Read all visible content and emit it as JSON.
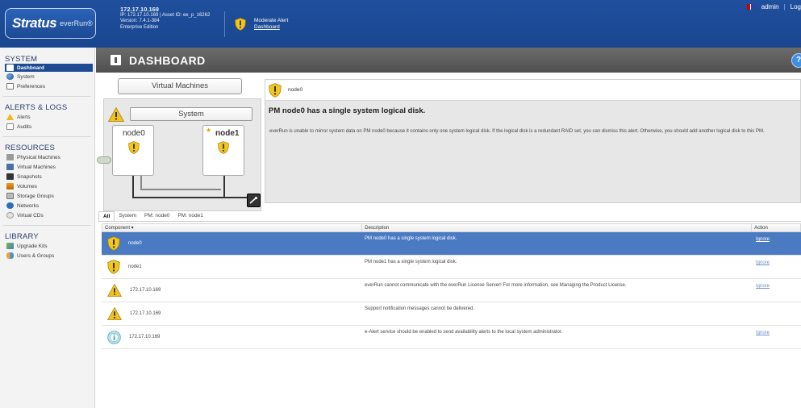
{
  "header": {
    "brand": "Stratus",
    "product": "everRun®",
    "host_ip": "172.17.10.169",
    "ip_line": "IP: 172.17.10.169 | Asset ID: ee_p_16262",
    "version": "Version: 7.4.1-384",
    "edition": "Enterprise Edition",
    "alert_level": "Moderate Alert",
    "alert_link": "Dashboard",
    "user": "admin",
    "logout": "Log"
  },
  "sidebar": {
    "system_title": "SYSTEM",
    "system_items": [
      {
        "label": "Dashboard",
        "icon": "dashboard-icon"
      },
      {
        "label": "System",
        "icon": "globe-icon"
      },
      {
        "label": "Preferences",
        "icon": "preferences-icon"
      }
    ],
    "alerts_title": "ALERTS & LOGS",
    "alerts_items": [
      {
        "label": "Alerts",
        "icon": "warning-icon"
      },
      {
        "label": "Audits",
        "icon": "document-icon"
      }
    ],
    "resources_title": "RESOURCES",
    "resources_items": [
      {
        "label": "Physical Machines",
        "icon": "server-icon"
      },
      {
        "label": "Virtual Machines",
        "icon": "vm-icon"
      },
      {
        "label": "Snapshots",
        "icon": "camera-icon"
      },
      {
        "label": "Volumes",
        "icon": "volume-icon"
      },
      {
        "label": "Storage Groups",
        "icon": "storage-icon"
      },
      {
        "label": "Networks",
        "icon": "network-icon"
      },
      {
        "label": "Virtual CDs",
        "icon": "cd-icon"
      }
    ],
    "library_title": "LIBRARY",
    "library_items": [
      {
        "label": "Upgrade Kits",
        "icon": "upgrade-icon"
      },
      {
        "label": "Users & Groups",
        "icon": "users-icon"
      }
    ]
  },
  "page_title": "DASHBOARD",
  "help": "?",
  "diagram": {
    "vm_button": "Virtual Machines",
    "system_button": "System",
    "node0": "node0",
    "node1": "node1"
  },
  "detail": {
    "node": "node0",
    "title": "PM node0 has a single system logical disk.",
    "body": "everRun is unable to mirror system data on PM node0 because it contains only one system logical disk. If the logical disk is a redundant RAID set, you can dismiss this alert. Otherwise, you should add another logical disk to this PM."
  },
  "tabs": [
    "All",
    "System",
    "PM: node0",
    "PM: node1"
  ],
  "table": {
    "columns": [
      "Component ▾",
      "Description",
      "Action"
    ],
    "rows": [
      {
        "component": "node0",
        "icon": "shield-alert-icon",
        "description": "PM node0 has a single system logical disk.",
        "action": "Ignore",
        "selected": true
      },
      {
        "component": "node1",
        "icon": "shield-alert-icon",
        "description": "PM node1 has a single system logical disk.",
        "action": "Ignore",
        "selected": false
      },
      {
        "component": "172.17.10.169",
        "icon": "warning-icon",
        "description": "everRun cannot communicate with the everRun License Server! For more information, see Managing the Product License.",
        "action": "Ignore",
        "selected": false
      },
      {
        "component": "172.17.10.169",
        "icon": "warning-icon",
        "description": "Support notification messages cannot be delivered.",
        "action": "",
        "selected": false
      },
      {
        "component": "172.17.10.169",
        "icon": "info-icon",
        "description": "e-Alert service should be enabled to send availability alerts to the local system administrator.",
        "action": "Ignore",
        "selected": false
      }
    ]
  },
  "colors": {
    "header_blue": "#1f4f9d",
    "selected_row": "#4a7bc2",
    "alert_yellow": "#f2c21a"
  }
}
